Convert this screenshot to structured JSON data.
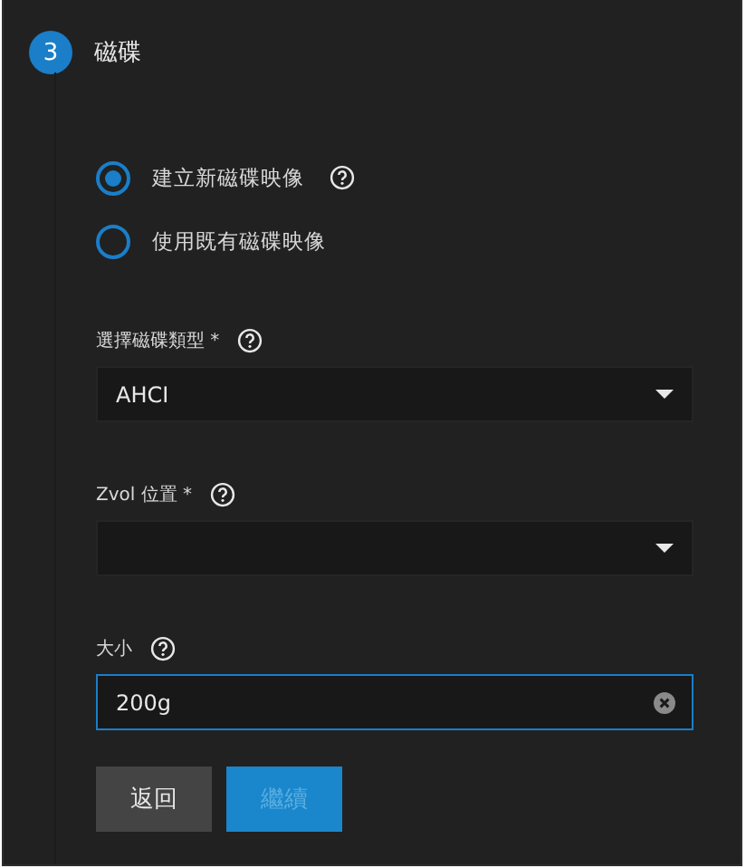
{
  "step": {
    "number": "3",
    "title": "磁碟"
  },
  "radios": [
    {
      "label": "建立新磁碟映像",
      "selected": true,
      "help": true
    },
    {
      "label": "使用既有磁碟映像",
      "selected": false,
      "help": false
    }
  ],
  "fields": [
    {
      "kind": "select",
      "label": "選擇磁碟類型 *",
      "value": "AHCI",
      "focused": false
    },
    {
      "kind": "select",
      "label": "Zvol 位置 *",
      "focused": false
    },
    {
      "kind": "input",
      "label": "大小",
      "value": "200g",
      "focused": true
    }
  ],
  "buttons": [
    {
      "label": "返回",
      "kind": "back",
      "disabled": false
    },
    {
      "label": "繼續",
      "kind": "next",
      "disabled": true
    }
  ]
}
